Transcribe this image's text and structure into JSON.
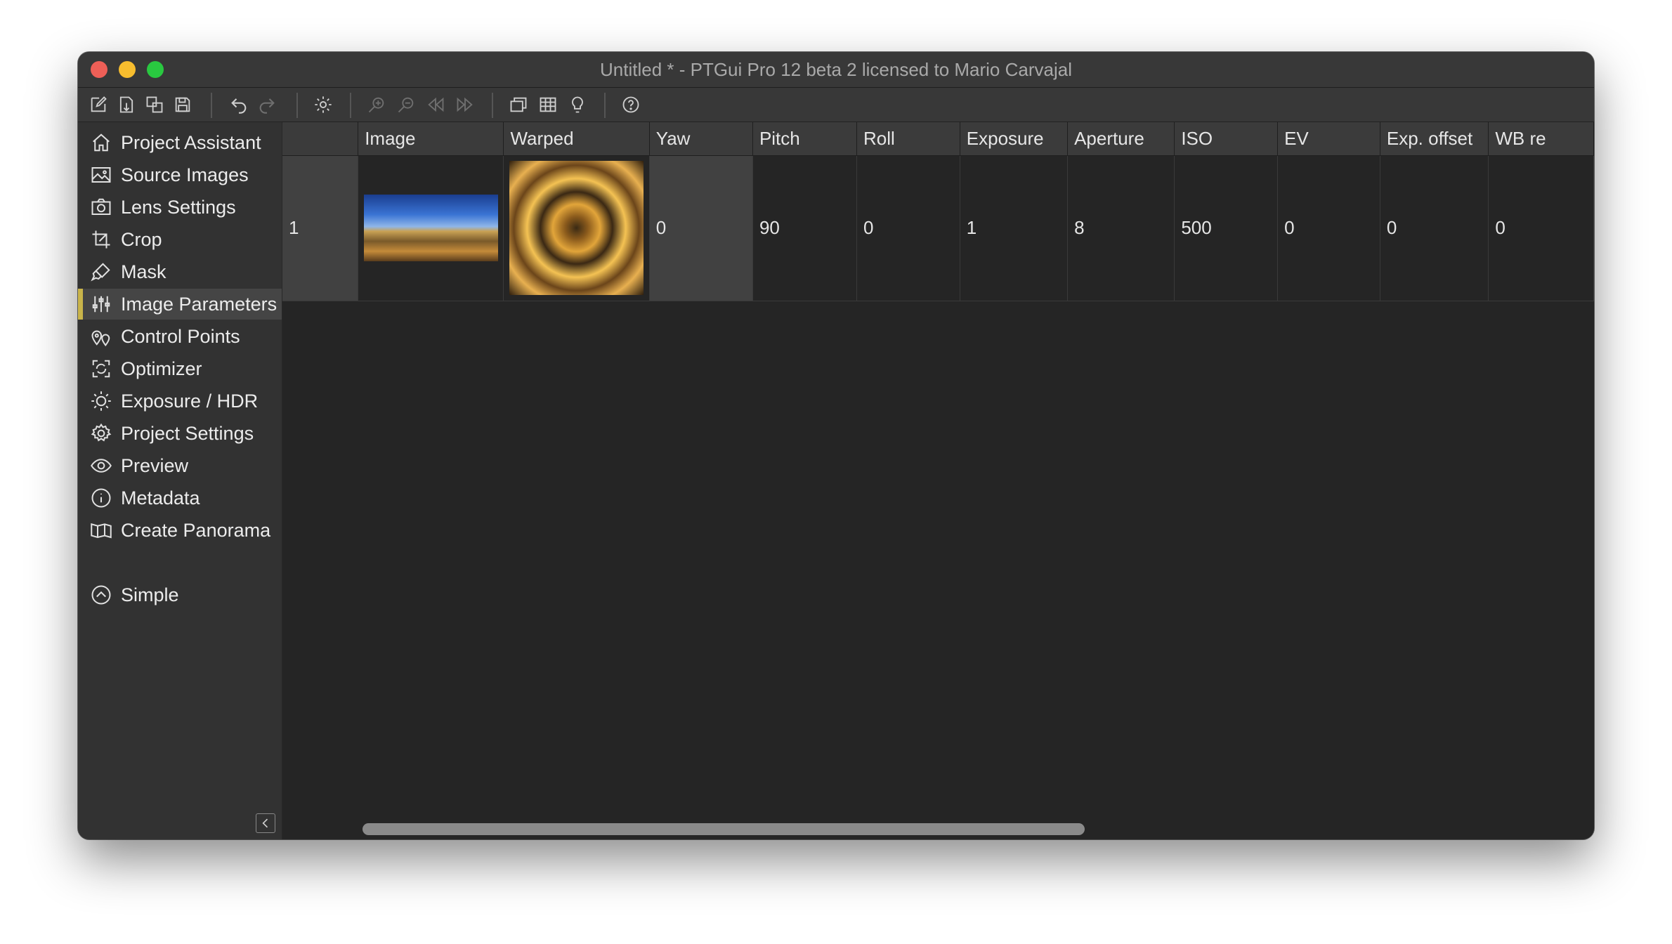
{
  "window": {
    "title": "Untitled * - PTGui Pro 12 beta 2 licensed to Mario Carvajal"
  },
  "toolbar": {
    "buttons": [
      "new-project-icon",
      "open-project-icon",
      "duplicate-icon",
      "save-icon",
      "undo-icon",
      "redo-icon",
      "settings-icon",
      "zoom-in-icon",
      "zoom-out-icon",
      "previous-icon",
      "next-icon",
      "panorama-editor-icon",
      "table-icon",
      "lightbulb-icon",
      "help-icon"
    ]
  },
  "sidebar": {
    "items": [
      {
        "label": "Project Assistant",
        "icon": "home-icon"
      },
      {
        "label": "Source Images",
        "icon": "image-icon"
      },
      {
        "label": "Lens Settings",
        "icon": "camera-icon"
      },
      {
        "label": "Crop",
        "icon": "crop-icon"
      },
      {
        "label": "Mask",
        "icon": "brush-icon"
      },
      {
        "label": "Image Parameters",
        "icon": "sliders-icon"
      },
      {
        "label": "Control Points",
        "icon": "location-pins-icon"
      },
      {
        "label": "Optimizer",
        "icon": "optimizer-icon"
      },
      {
        "label": "Exposure / HDR",
        "icon": "sun-icon"
      },
      {
        "label": "Project Settings",
        "icon": "gear-icon"
      },
      {
        "label": "Preview",
        "icon": "eye-icon"
      },
      {
        "label": "Metadata",
        "icon": "info-icon"
      },
      {
        "label": "Create Panorama",
        "icon": "map-icon"
      }
    ],
    "active_index": 5,
    "simple": {
      "label": "Simple",
      "icon": "chevron-up-circle-icon"
    },
    "accent_color": "#c9b44a"
  },
  "table": {
    "columns": [
      "",
      "Image",
      "Warped",
      "Yaw",
      "Pitch",
      "Roll",
      "Exposure",
      "Aperture",
      "ISO",
      "EV",
      "Exp. offset",
      "WB re"
    ],
    "rows": [
      {
        "index": "1",
        "yaw": "0",
        "pitch": "90",
        "roll": "0",
        "exposure": "1",
        "aperture": "8",
        "iso": "500",
        "ev": "0",
        "exp_offset": "0",
        "wb": "0"
      }
    ]
  }
}
